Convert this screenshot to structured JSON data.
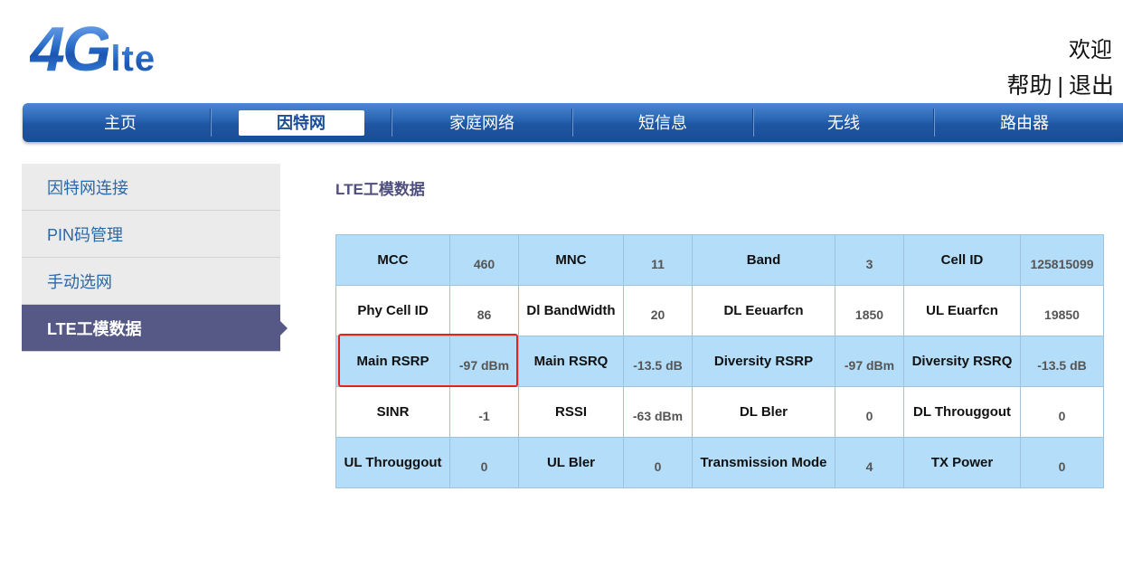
{
  "logo": {
    "main": "4G",
    "sub": "lte"
  },
  "header": {
    "welcome": "欢迎",
    "help": "帮助",
    "separator": "|",
    "logout": "退出"
  },
  "nav": {
    "items": [
      {
        "label": "主页",
        "active": false
      },
      {
        "label": "因特网",
        "active": true
      },
      {
        "label": "家庭网络",
        "active": false
      },
      {
        "label": "短信息",
        "active": false
      },
      {
        "label": "无线",
        "active": false
      },
      {
        "label": "路由器",
        "active": false
      }
    ]
  },
  "sidebar": {
    "items": [
      {
        "label": "因特网连接",
        "active": false
      },
      {
        "label": "PIN码管理",
        "active": false
      },
      {
        "label": "手动选网",
        "active": false
      },
      {
        "label": "LTE工模数据",
        "active": true
      }
    ]
  },
  "main": {
    "title": "LTE工模数据",
    "table": {
      "rows": [
        [
          {
            "label": "MCC",
            "value": "460"
          },
          {
            "label": "MNC",
            "value": "11"
          },
          {
            "label": "Band",
            "value": "3"
          },
          {
            "label": "Cell ID",
            "value": "125815099"
          }
        ],
        [
          {
            "label": "Phy Cell ID",
            "value": "86"
          },
          {
            "label": "Dl BandWidth",
            "value": "20"
          },
          {
            "label": "DL Eeuarfcn",
            "value": "1850"
          },
          {
            "label": "UL Euarfcn",
            "value": "19850"
          }
        ],
        [
          {
            "label": "Main RSRP",
            "value": "-97 dBm",
            "highlighted": true
          },
          {
            "label": "Main RSRQ",
            "value": "-13.5 dB"
          },
          {
            "label": "Diversity RSRP",
            "value": "-97 dBm"
          },
          {
            "label": "Diversity RSRQ",
            "value": "-13.5 dB"
          }
        ],
        [
          {
            "label": "SINR",
            "value": "-1"
          },
          {
            "label": "RSSI",
            "value": "-63 dBm"
          },
          {
            "label": "DL Bler",
            "value": "0"
          },
          {
            "label": "DL Througgout",
            "value": "0"
          }
        ],
        [
          {
            "label": "UL Througgout",
            "value": "0"
          },
          {
            "label": "UL Bler",
            "value": "0"
          },
          {
            "label": "Transmission Mode",
            "value": "4"
          },
          {
            "label": "TX Power",
            "value": "0"
          }
        ]
      ]
    }
  },
  "colors": {
    "logo_blue": "#2f73cf",
    "nav_blue": "#2663b1",
    "nav_active_text": "#1c4c97",
    "sidebar_bg": "#ebebeb",
    "sidebar_text": "#2b68a6",
    "sidebar_active": "#565986",
    "title": "#4e4f7f",
    "row_blue": "#b3ddf8",
    "table_border": "#9fc3df",
    "value_text": "#555555",
    "highlight": "#e0251c"
  }
}
